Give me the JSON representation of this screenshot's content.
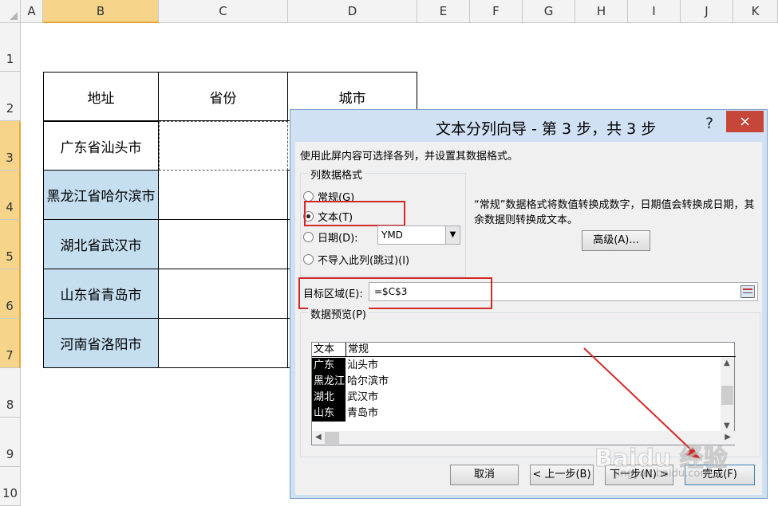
{
  "columns": [
    "A",
    "B",
    "C",
    "D",
    "E",
    "F",
    "G",
    "H",
    "I",
    "J",
    "K"
  ],
  "rows": [
    "1",
    "2",
    "3",
    "4",
    "5",
    "6",
    "7",
    "8",
    "9",
    "10"
  ],
  "table": {
    "headers": [
      "地址",
      "省份",
      "城市"
    ],
    "addresses": [
      "广东省汕头市",
      "黑龙江省哈尔滨市",
      "湖北省武汉市",
      "山东省青岛市",
      "河南省洛阳市"
    ]
  },
  "dialog": {
    "title": "文本分列向导 - 第 3 步，共 3 步",
    "help": "?",
    "close": "×",
    "description": "使用此屏内容可选择各列，并设置其数据格式。",
    "format_group_title": "列数据格式",
    "options": {
      "general": "常规(G)",
      "text": "文本(T)",
      "date": "日期(D):",
      "skip": "不导入此列(跳过)(I)"
    },
    "date_format": "YMD",
    "selected_option": "text",
    "note": "“常规”数据格式将数值转换成数字，日期值会转换成日期，其余数据则转换成文本。",
    "advanced_button": "高级(A)...",
    "target_label": "目标区域(E):",
    "target_value": "=$C$3",
    "preview_title": "数据预览(P)",
    "preview": {
      "headers": [
        "文本",
        "常规"
      ],
      "col1": [
        "广东",
        "黑龙江",
        "湖北",
        "山东"
      ],
      "col2": [
        "汕头市",
        "哈尔滨市",
        "武汉市",
        "青岛市"
      ]
    },
    "buttons": {
      "cancel": "取消",
      "back": "< 上一步(B)",
      "next": "下一步(N) >",
      "finish": "完成(F)"
    }
  },
  "watermark": {
    "logo": "Baidu 经验",
    "url": "jingyan.baidu.com"
  },
  "colors": {
    "highlight_red": "#d42828",
    "selected_cell_fill": "#c5dff1",
    "dialog_frame": "#cfe0f3",
    "close_button": "#c7463a"
  }
}
